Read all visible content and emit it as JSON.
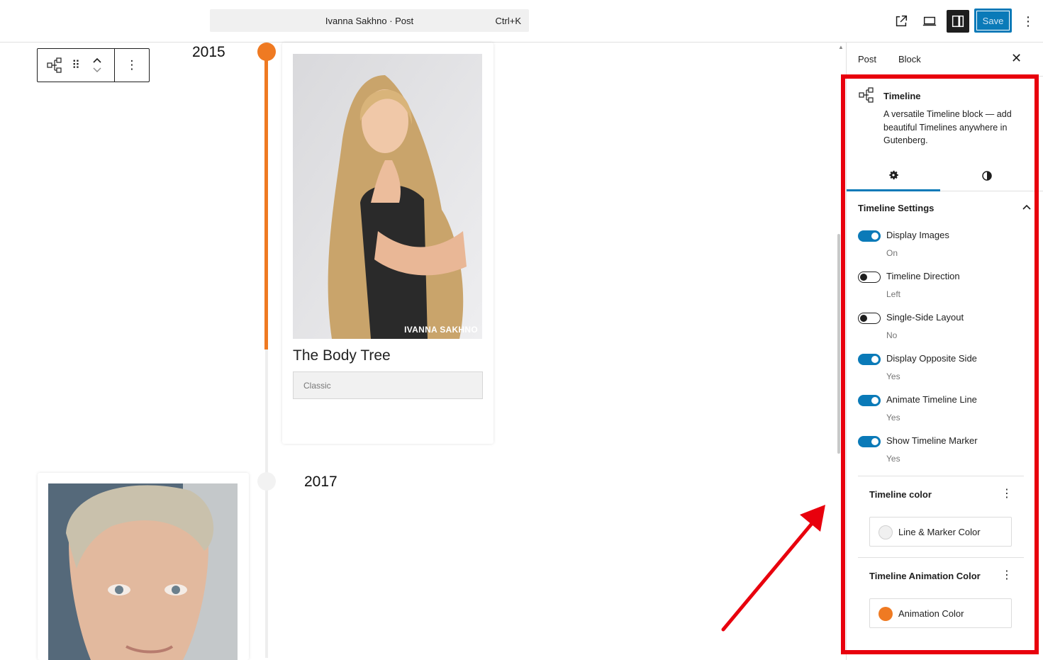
{
  "topbar": {
    "document_title": "Ivanna Sakhno · Post",
    "shortcut": "Ctrl+K",
    "save_label": "Save"
  },
  "canvas": {
    "entries": [
      {
        "year": "2015",
        "card_title": "The Body Tree",
        "card_button": "Classic",
        "watermark": "IVANNA SAKHNO"
      },
      {
        "year": "2017"
      }
    ]
  },
  "sidebar": {
    "tabs": [
      "Post",
      "Block"
    ],
    "block": {
      "title": "Timeline",
      "description": "A versatile Timeline block — add beautiful Timelines anywhere in Gutenberg."
    },
    "panel_title": "Timeline Settings",
    "toggles": [
      {
        "label": "Display Images",
        "help": "On",
        "on": true
      },
      {
        "label": "Timeline Direction",
        "help": "Left",
        "on": false
      },
      {
        "label": "Single-Side Layout",
        "help": "No",
        "on": false
      },
      {
        "label": "Display Opposite Side",
        "help": "Yes",
        "on": true
      },
      {
        "label": "Animate Timeline Line",
        "help": "Yes",
        "on": true
      },
      {
        "label": "Show Timeline Marker",
        "help": "Yes",
        "on": true
      }
    ],
    "colors": [
      {
        "heading": "Timeline color",
        "button": "Line & Marker Color",
        "swatch": "#f0f0f0"
      },
      {
        "heading": "Timeline Animation Color",
        "button": "Animation Color",
        "swatch": "#ef7a22"
      }
    ]
  },
  "theme": {
    "accent": "#0a7ab8",
    "timeline_orange": "#ef7a22",
    "annotation_red": "#e8000d"
  }
}
